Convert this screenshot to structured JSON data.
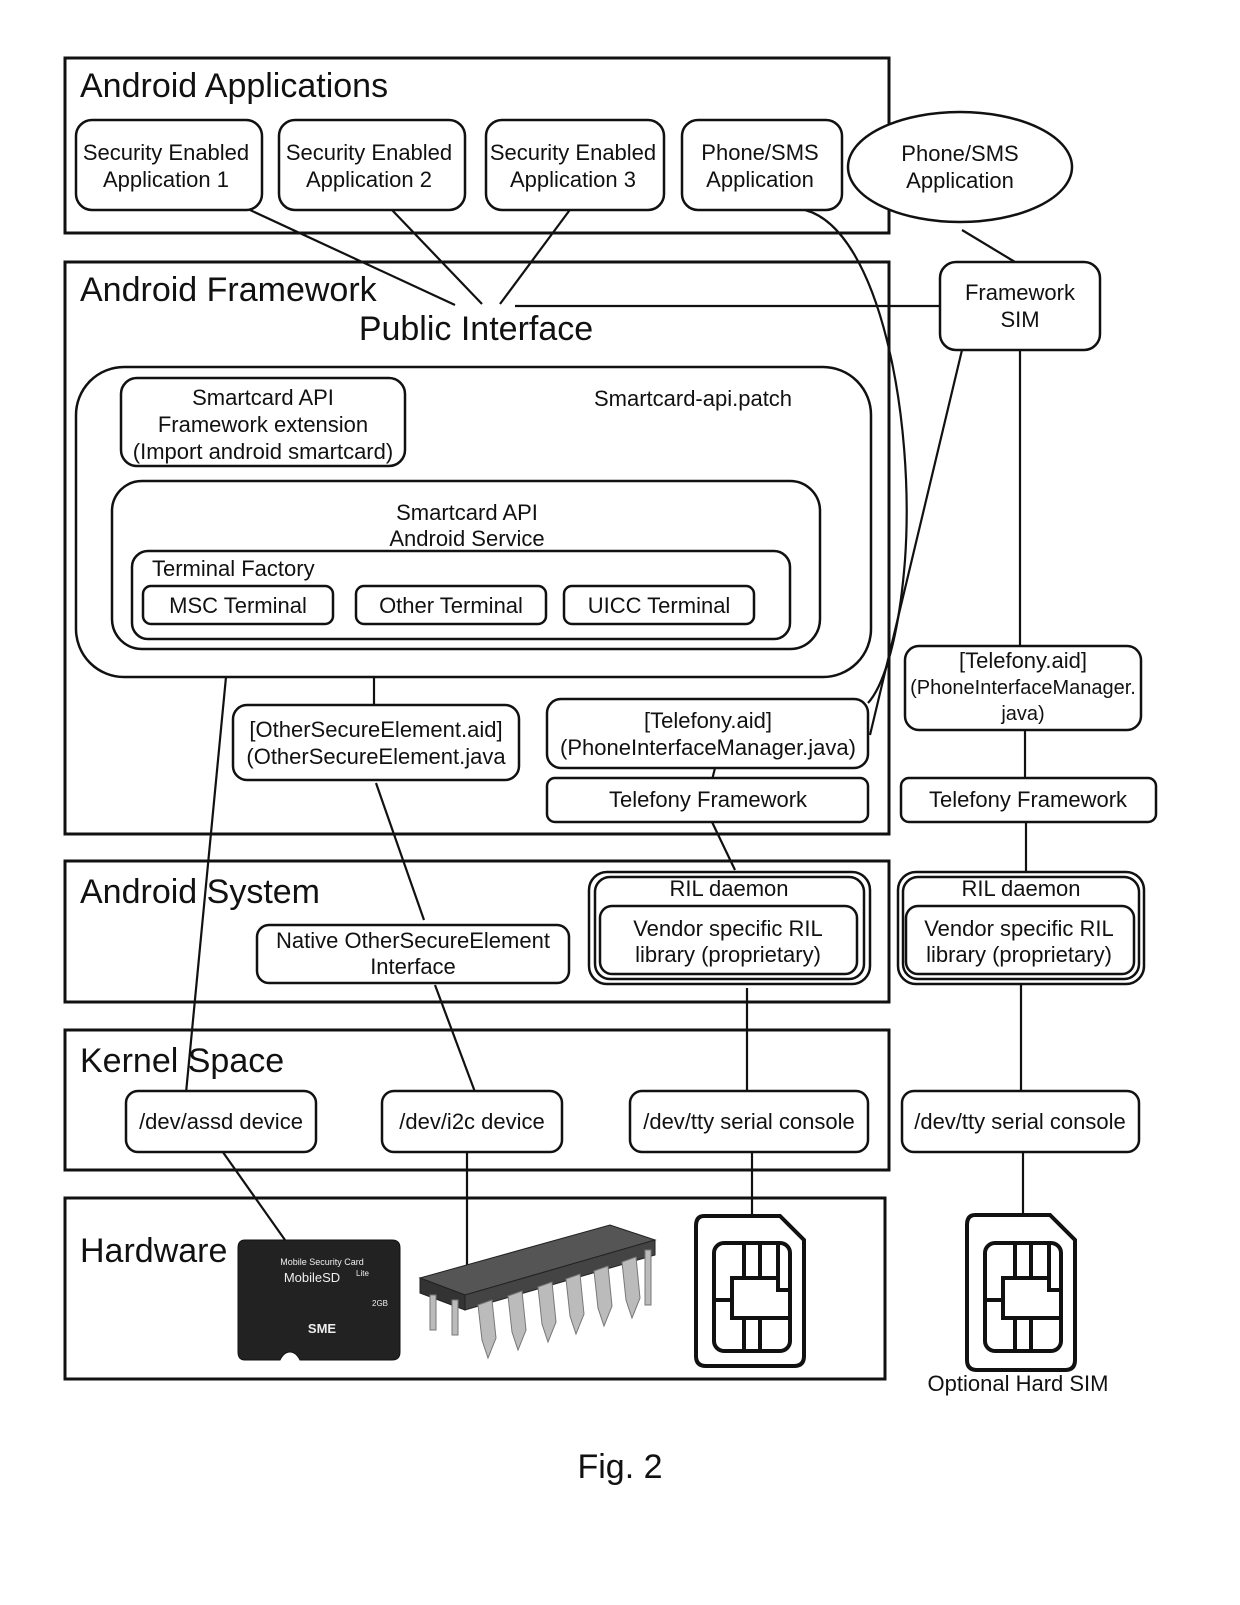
{
  "figure": {
    "caption": "Fig. 2",
    "layers": {
      "applications": "Android Applications",
      "framework": "Android Framework",
      "system": "Android System",
      "kernel": "Kernel Space",
      "hardware": "Hardware"
    },
    "public_interface": "Public Interface",
    "apps": [
      {
        "line1": "Security Enabled",
        "line2": "Application 1"
      },
      {
        "line1": "Security Enabled",
        "line2": "Application 2"
      },
      {
        "line1": "Security Enabled",
        "line2": "Application 3"
      },
      {
        "line1": "Phone/SMS",
        "line2": "Application"
      }
    ],
    "external_app": {
      "line1": "Phone/SMS",
      "line2": "Application"
    },
    "framework_sim": {
      "line1": "Framework",
      "line2": "SIM"
    },
    "smartcard_patch": {
      "label": "Smartcard-api.patch",
      "extension": {
        "line1": "Smartcard API",
        "line2": "Framework extension",
        "line3": "(Import android smartcard)"
      },
      "service": {
        "line1": "Smartcard API",
        "line2": "Android Service"
      },
      "terminal_factory": "Terminal Factory",
      "terminals": [
        "MSC Terminal",
        "Other Terminal",
        "UICC Terminal"
      ]
    },
    "other_se_aid": {
      "line1": "[OtherSecureElement.aid]",
      "line2": "(OtherSecureElement.java"
    },
    "telefony_aid": {
      "line1": "[Telefony.aid]",
      "line2": "(PhoneInterfaceManager.java)"
    },
    "telefony_framework": "Telefony Framework",
    "native_se": {
      "line1": "Native OtherSecureElement",
      "line2": "Interface"
    },
    "ril": {
      "daemon": "RIL daemon",
      "lib_line1": "Vendor specific RIL",
      "lib_line2": "library (proprietary)"
    },
    "devices": [
      "/dev/assd device",
      "/dev/i2c device",
      "/dev/tty serial console"
    ],
    "right_stack": {
      "telefony_aid": {
        "line1": "[Telefony.aid]",
        "line2": "(PhoneInterfaceManager.",
        "line3": "java)"
      },
      "telefony_framework": "Telefony Framework",
      "ril_daemon": "RIL daemon",
      "ril_lib_line1": "Vendor specific RIL",
      "ril_lib_line2": "library (proprietary)",
      "device": "/dev/tty serial console",
      "sim_caption": "Optional Hard SIM"
    },
    "hardware_items": {
      "sd_card": {
        "line1": "Mobile Security Card",
        "line2": "MobileSD",
        "sup": "Lite",
        "brand": "SME",
        "size": "2GB"
      },
      "chip": "integrated-circuit",
      "sim": "sim-card"
    }
  }
}
